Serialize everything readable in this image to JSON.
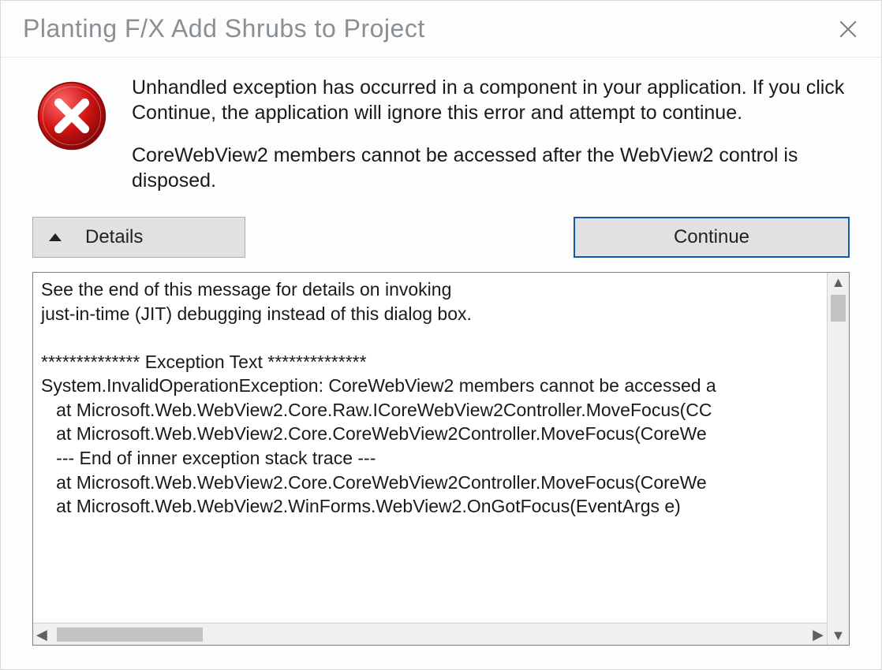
{
  "dialog": {
    "title": "Planting F/X Add Shrubs to Project",
    "close_aria": "Close"
  },
  "message": {
    "para1": "Unhandled exception has occurred in a component in your application. If you click Continue, the application will ignore this error and attempt to continue.",
    "para2": "CoreWebView2 members cannot be accessed after the WebView2 control is disposed."
  },
  "buttons": {
    "details_label": "Details",
    "continue_label": "Continue"
  },
  "details": {
    "text": "See the end of this message for details on invoking\njust-in-time (JIT) debugging instead of this dialog box.\n\n************** Exception Text **************\nSystem.InvalidOperationException: CoreWebView2 members cannot be accessed a\n   at Microsoft.Web.WebView2.Core.Raw.ICoreWebView2Controller.MoveFocus(CC\n   at Microsoft.Web.WebView2.Core.CoreWebView2Controller.MoveFocus(CoreWe\n   --- End of inner exception stack trace ---\n   at Microsoft.Web.WebView2.Core.CoreWebView2Controller.MoveFocus(CoreWe\n   at Microsoft.Web.WebView2.WinForms.WebView2.OnGotFocus(EventArgs e)"
  }
}
